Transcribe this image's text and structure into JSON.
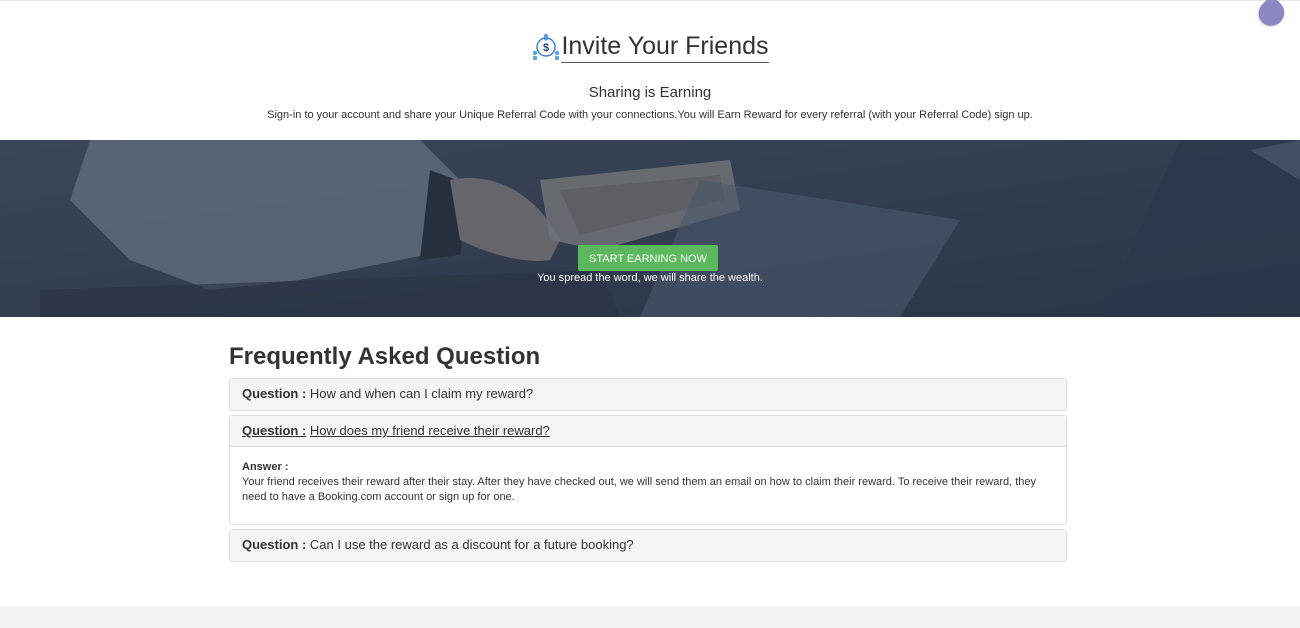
{
  "header": {
    "title": "Invite Your Friends",
    "subtitle": "Sharing is Earning",
    "description": "Sign-in to your account and share your Unique Referral Code with your connections.You will Earn Reward for every referral (with your Referral Code) sign up."
  },
  "hero": {
    "cta_label": "START EARNING NOW",
    "tagline": "You spread the word, we will share the wealth.",
    "cta_color": "#5cb85c"
  },
  "faq": {
    "title": "Frequently Asked Question",
    "question_prefix": "Question :",
    "answer_prefix": "Answer :",
    "items": [
      {
        "question": "How and when can I claim my reward?"
      },
      {
        "question": "How does my friend receive their reward?",
        "answer": "Your friend receives their reward after their stay. After they have checked out, we will send them an email on how to claim their reward. To receive their reward, they need to have a Booking.com account or sign up for one."
      },
      {
        "question": "Can I use the reward as a discount for a future booking?"
      }
    ]
  },
  "icons": {
    "title_icon": "referral-network-icon",
    "floating_icon": "drop-icon"
  }
}
